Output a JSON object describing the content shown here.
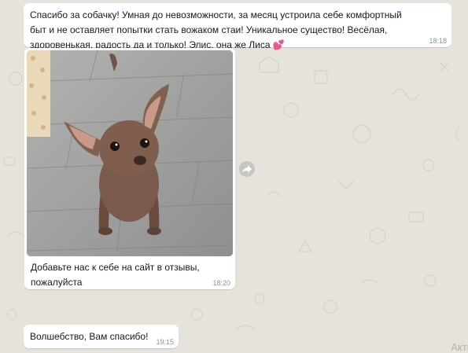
{
  "messages": [
    {
      "text": "Спасибо за собачку! Умная до невозможности, за месяц устроила себе комфортный быт и не оставляет попытки стать вожаком стаи! Уникальное существо! Весёлая, здоровенькая, радость да и только! Элис, она же Лиса",
      "emoji": "💕",
      "time": "18:18"
    },
    {
      "text": "Добавьте нас к себе на сайт в отзывы, пожалуйста",
      "time": "18:20",
      "image": "chihuahua-photo"
    },
    {
      "text": "Волшебство, Вам спасибо!",
      "time": "19:15"
    }
  ],
  "corner_text": "Акти",
  "icons": {
    "forward": "forward-icon"
  },
  "colors": {
    "bubble": "#ffffff",
    "background": "#e6e2dc",
    "time": "#8696a0"
  }
}
